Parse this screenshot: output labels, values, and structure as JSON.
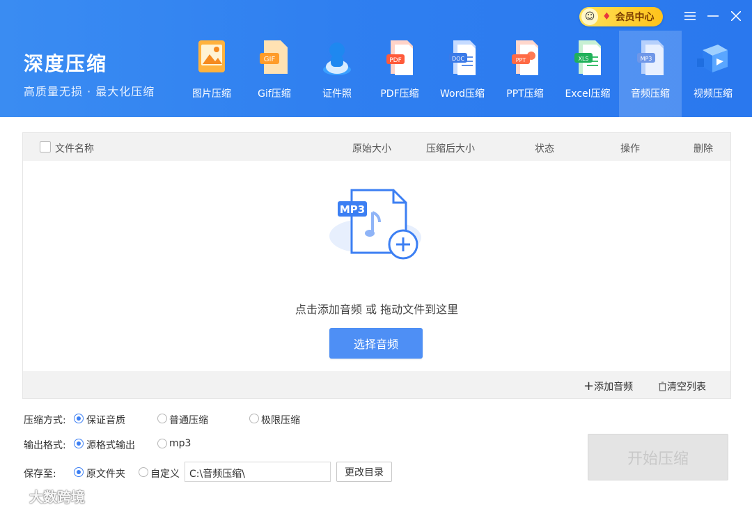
{
  "brand": {
    "title": "深度压缩",
    "subtitle": "高质量无损 · 最大化压缩"
  },
  "header": {
    "vip_label": "会员中心",
    "menu_icon": "menu-icon",
    "minimize_icon": "minimize-icon",
    "close_icon": "close-icon"
  },
  "tabs": [
    {
      "label": "图片压缩",
      "icon": "image-file-icon"
    },
    {
      "label": "Gif压缩",
      "icon": "gif-file-icon"
    },
    {
      "label": "证件照",
      "icon": "id-photo-icon"
    },
    {
      "label": "PDF压缩",
      "icon": "pdf-file-icon"
    },
    {
      "label": "Word压缩",
      "icon": "word-file-icon"
    },
    {
      "label": "PPT压缩",
      "icon": "ppt-file-icon"
    },
    {
      "label": "Excel压缩",
      "icon": "excel-file-icon"
    },
    {
      "label": "音频压缩",
      "icon": "mp3-file-icon",
      "active": true
    },
    {
      "label": "视频压缩",
      "icon": "video-file-icon"
    }
  ],
  "table": {
    "columns": [
      "文件名称",
      "原始大小",
      "压缩后大小",
      "状态",
      "操作",
      "删除"
    ]
  },
  "drop": {
    "badge": "MP3",
    "hint": "点击添加音频 或 拖动文件到这里",
    "button": "选择音频"
  },
  "panel_footer": {
    "add": "添加音频",
    "clear": "清空列表"
  },
  "options": {
    "compress_label": "压缩方式:",
    "compress_modes": [
      "保证音质",
      "普通压缩",
      "极限压缩"
    ],
    "compress_selected": "保证音质",
    "format_label": "输出格式:",
    "formats": [
      "源格式输出",
      "mp3"
    ],
    "format_selected": "源格式输出",
    "save_label": "保存至:",
    "save_modes": [
      "原文件夹",
      "自定义"
    ],
    "save_selected": "原文件夹",
    "path": "C:\\音频压缩\\",
    "change_dir": "更改目录"
  },
  "start_button": "开始压缩",
  "watermark": "大数跨境",
  "colors": {
    "header": "#2f7ff0",
    "accent": "#4e8ff5",
    "vip": "#ffc21a"
  }
}
